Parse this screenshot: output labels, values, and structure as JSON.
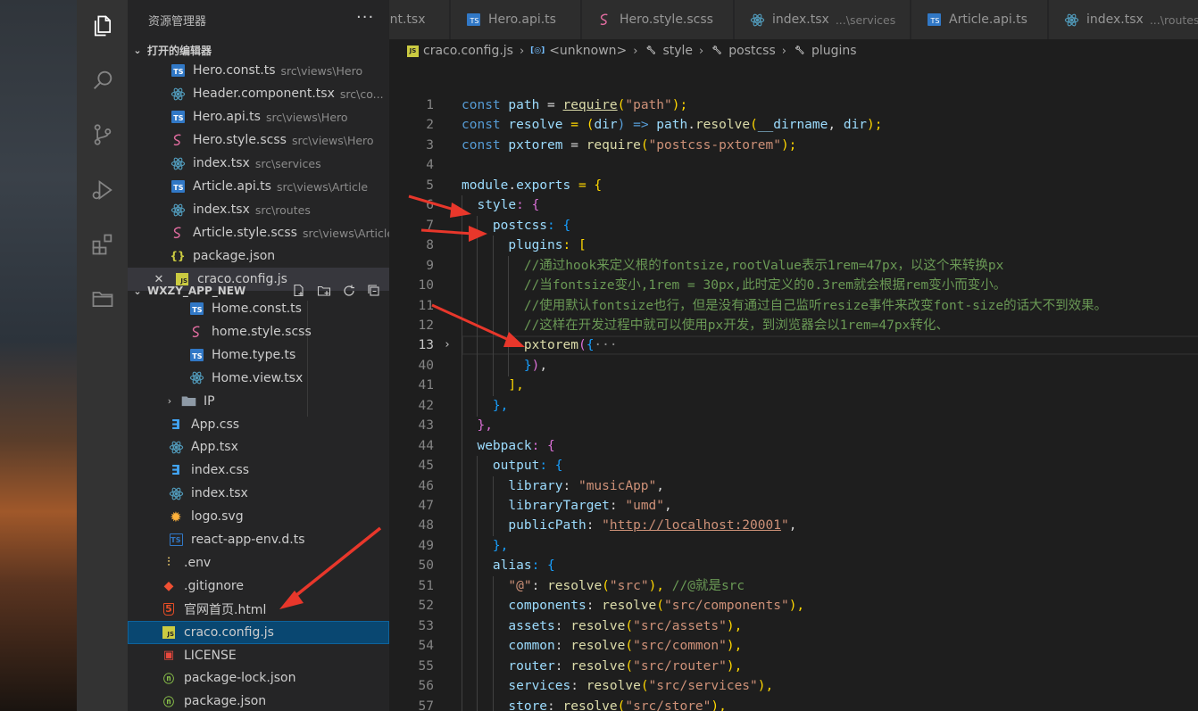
{
  "activity_bar": {
    "icons": [
      "explorer-icon",
      "search-icon",
      "source-control-icon",
      "run-debug-icon",
      "extensions-icon",
      "folder-icon"
    ]
  },
  "sidebar": {
    "title": "资源管理器",
    "more": "···",
    "open_editors_header": "打开的编辑器",
    "open_editors": [
      {
        "name": "Hero.const.ts",
        "desc": "src\\views\\Hero",
        "icon": "ts"
      },
      {
        "name": "Header.component.tsx",
        "desc": "src\\co...",
        "icon": "react"
      },
      {
        "name": "Hero.api.ts",
        "desc": "src\\views\\Hero",
        "icon": "ts"
      },
      {
        "name": "Hero.style.scss",
        "desc": "src\\views\\Hero",
        "icon": "scss"
      },
      {
        "name": "index.tsx",
        "desc": "src\\services",
        "icon": "react"
      },
      {
        "name": "Article.api.ts",
        "desc": "src\\views\\Article",
        "icon": "ts"
      },
      {
        "name": "index.tsx",
        "desc": "src\\routes",
        "icon": "react"
      },
      {
        "name": "Article.style.scss",
        "desc": "src\\views\\Article",
        "icon": "scss"
      },
      {
        "name": "package.json",
        "desc": "",
        "icon": "json"
      },
      {
        "name": "craco.config.js",
        "desc": "",
        "icon": "js"
      }
    ],
    "project_header": "WXZY_APP_NEW",
    "tree": [
      {
        "name": "Home.const.ts",
        "icon": "ts",
        "indent": 2
      },
      {
        "name": "home.style.scss",
        "icon": "scss",
        "indent": 2
      },
      {
        "name": "Home.type.ts",
        "icon": "ts",
        "indent": 2
      },
      {
        "name": "Home.view.tsx",
        "icon": "react",
        "indent": 2
      },
      {
        "name": "IP",
        "icon": "folder",
        "indent": 1,
        "twisty": "›"
      },
      {
        "name": "App.css",
        "icon": "css",
        "indent": 1
      },
      {
        "name": "App.tsx",
        "icon": "react",
        "indent": 1
      },
      {
        "name": "index.css",
        "icon": "css",
        "indent": 1
      },
      {
        "name": "index.tsx",
        "icon": "react",
        "indent": 1
      },
      {
        "name": "logo.svg",
        "icon": "svg",
        "indent": 1
      },
      {
        "name": "react-app-env.d.ts",
        "icon": "ts-outline",
        "indent": 1
      },
      {
        "name": ".env",
        "icon": "env",
        "indent": 0
      },
      {
        "name": ".gitignore",
        "icon": "git",
        "indent": 0
      },
      {
        "name": "官网首页.html",
        "icon": "html",
        "indent": 0
      },
      {
        "name": "craco.config.js",
        "icon": "js",
        "indent": 0
      },
      {
        "name": "LICENSE",
        "icon": "license",
        "indent": 0
      },
      {
        "name": "package-lock.json",
        "icon": "npm",
        "indent": 0
      },
      {
        "name": "package.json",
        "icon": "npm",
        "indent": 0
      }
    ]
  },
  "tabs": [
    {
      "name": "ent.tsx",
      "desc": "",
      "icon": "none"
    },
    {
      "name": "Hero.api.ts",
      "desc": "",
      "icon": "ts"
    },
    {
      "name": "Hero.style.scss",
      "desc": "",
      "icon": "scss"
    },
    {
      "name": "index.tsx",
      "desc": "...\\services",
      "icon": "react"
    },
    {
      "name": "Article.api.ts",
      "desc": "",
      "icon": "ts"
    },
    {
      "name": "index.tsx",
      "desc": "...\\routes",
      "icon": "react"
    }
  ],
  "breadcrumbs": [
    "craco.config.js",
    "<unknown>",
    "style",
    "postcss",
    "plugins"
  ],
  "code": {
    "line_numbers": [
      "1",
      "2",
      "3",
      "4",
      "5",
      "6",
      "7",
      "8",
      "9",
      "10",
      "11",
      "12",
      "13",
      "40",
      "41",
      "42",
      "43",
      "44",
      "45",
      "46",
      "47",
      "48",
      "49",
      "50",
      "51",
      "52",
      "53",
      "54",
      "55",
      "56",
      "57"
    ],
    "current_line": "13",
    "lines": {
      "l1": [
        "const",
        "path",
        "=",
        "require",
        "(",
        "\"path\"",
        ");"
      ],
      "l2": [
        "const",
        "resolve",
        "= (",
        "dir",
        ") =>",
        "path",
        ".",
        "resolve",
        "(",
        "__dirname",
        ", ",
        "dir",
        ");"
      ],
      "l3": [
        "const",
        "pxtorem",
        "=",
        "require",
        "(",
        "\"postcss-pxtorem\"",
        ");"
      ],
      "l5": [
        "module",
        ".",
        "exports",
        " = {"
      ],
      "l6": [
        "style",
        ": {"
      ],
      "l7": [
        "postcss",
        ": {"
      ],
      "l8": [
        "plugins",
        ": ["
      ],
      "l9": "//通过hook来定义根的fontsize,rootValue表示1rem=47px，以这个来转换px",
      "l10": "//当fontsize变小,1rem = 30px,此时定义的0.3rem就会根据rem变小而变小。",
      "l11": "//使用默认fontsize也行，但是没有通过自己监听resize事件来改变font-size的话大不到效果。",
      "l12": "//这样在开发过程中就可以使用px开发，到浏览器会以1rem=47px转化、",
      "l13": [
        "pxtorem",
        "(",
        "{",
        "···"
      ],
      "l40": [
        "}",
        ")",
        ","
      ],
      "l41": [
        "],"
      ],
      "l42": [
        "},"
      ],
      "l43": [
        "},"
      ],
      "l44": [
        "webpack",
        ": {"
      ],
      "l45": [
        "output",
        ": {"
      ],
      "l46": [
        "library",
        ": ",
        "\"musicApp\"",
        ","
      ],
      "l47": [
        "libraryTarget",
        ": ",
        "\"umd\"",
        ","
      ],
      "l48": [
        "publicPath",
        ": ",
        "\"",
        "http://localhost:20001",
        "\"",
        ","
      ],
      "l49": [
        "},"
      ],
      "l50": [
        "alias",
        ": {"
      ],
      "l51": [
        "\"@\"",
        ": ",
        "resolve",
        "(",
        "\"src\"",
        "), ",
        "//@就是src"
      ],
      "l52": [
        "components",
        ": ",
        "resolve",
        "(",
        "\"src/components\"",
        "),"
      ],
      "l53": [
        "assets",
        ": ",
        "resolve",
        "(",
        "\"src/assets\"",
        "),"
      ],
      "l54": [
        "common",
        ": ",
        "resolve",
        "(",
        "\"src/common\"",
        "),"
      ],
      "l55": [
        "router",
        ": ",
        "resolve",
        "(",
        "\"src/router\"",
        "),"
      ],
      "l56": [
        "services",
        ": ",
        "resolve",
        "(",
        "\"src/services\"",
        "),"
      ],
      "l57": [
        "store",
        ": ",
        "resolve",
        "(",
        "\"src/store\"",
        "),"
      ]
    }
  },
  "colors": {
    "annotation_arrow": "#e8372b",
    "selection": "#094771",
    "ts": "#3178c6",
    "react": "#519aba",
    "scss": "#e06c9f",
    "js": "#cbcb41"
  }
}
